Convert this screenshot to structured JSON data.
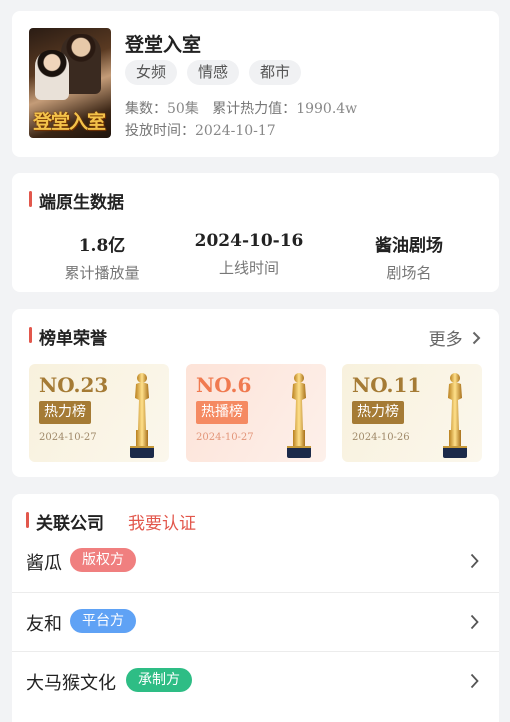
{
  "drama": {
    "cover_text": "登堂入室",
    "title": "登堂入室",
    "tags": [
      "女频",
      "情感",
      "都市"
    ],
    "episodes_label": "集数：",
    "episodes_value": "50集",
    "heat_label": "累计热力值：",
    "heat_value": "1990.4w",
    "release_label": "投放时间：",
    "release_value": "2024-10-17"
  },
  "native": {
    "title": "端原生数据",
    "stats": [
      {
        "value": "1.8亿",
        "label": "累计播放量"
      },
      {
        "value": "2024-10-16",
        "label": "上线时间"
      },
      {
        "value": "酱油剧场",
        "label": "剧场名"
      }
    ]
  },
  "honors": {
    "title": "榜单荣誉",
    "more": "更多",
    "ranks": [
      {
        "no": "NO.23",
        "board": "热力榜",
        "date": "2024-10-27"
      },
      {
        "no": "NO.6",
        "board": "热播榜",
        "date": "2024-10-27"
      },
      {
        "no": "NO.11",
        "board": "热力榜",
        "date": "2024-10-26"
      }
    ]
  },
  "companies": {
    "title": "关联公司",
    "verify": "我要认证",
    "items": [
      {
        "name": "酱瓜",
        "role": "版权方",
        "role_color": "#f07f7f"
      },
      {
        "name": "友和",
        "role": "平台方",
        "role_color": "#5fa2f5"
      },
      {
        "name": "大马猴文化",
        "role": "承制方",
        "role_color": "#2ebd85"
      }
    ]
  }
}
